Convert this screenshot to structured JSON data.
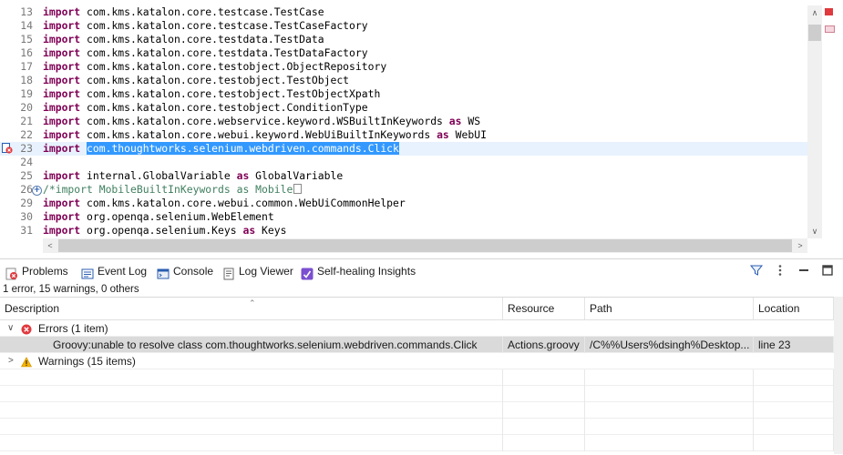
{
  "editor": {
    "lines": [
      {
        "num": "13",
        "kw": "import",
        "text": " com.kms.katalon.core.testcase.TestCase"
      },
      {
        "num": "14",
        "kw": "import",
        "text": " com.kms.katalon.core.testcase.TestCaseFactory"
      },
      {
        "num": "15",
        "kw": "import",
        "text": " com.kms.katalon.core.testdata.TestData"
      },
      {
        "num": "16",
        "kw": "import",
        "text": " com.kms.katalon.core.testdata.TestDataFactory"
      },
      {
        "num": "17",
        "kw": "import",
        "text": " com.kms.katalon.core.testobject.ObjectRepository"
      },
      {
        "num": "18",
        "kw": "import",
        "text": " com.kms.katalon.core.testobject.TestObject"
      },
      {
        "num": "19",
        "kw": "import",
        "text": " com.kms.katalon.core.testobject.TestObjectXpath"
      },
      {
        "num": "20",
        "kw": "import",
        "text": " com.kms.katalon.core.testobject.ConditionType"
      },
      {
        "num": "21",
        "kw": "import",
        "text": " com.kms.katalon.core.webservice.keyword.WSBuiltInKeywords ",
        "kw2": "as",
        "text2": " WS"
      },
      {
        "num": "22",
        "kw": "import",
        "text": " com.kms.katalon.core.webui.keyword.WebUiBuiltInKeywords ",
        "kw2": "as",
        "text2": " WebUI"
      },
      {
        "num": "23",
        "kw": "import",
        "text": " ",
        "selected": "com.thoughtworks.selenium.webdriven.commands.Click"
      },
      {
        "num": "24",
        "kw": "",
        "text": ""
      },
      {
        "num": "25",
        "kw": "import",
        "text": " internal.GlobalVariable ",
        "kw2": "as",
        "text2": " GlobalVariable"
      },
      {
        "num": "26",
        "comment": "/*import MobileBuiltInKeywords as Mobile"
      },
      {
        "num": "29",
        "kw": "import",
        "text": " com.kms.katalon.core.webui.common.WebUiCommonHelper"
      },
      {
        "num": "30",
        "kw": "import",
        "text": " org.openqa.selenium.WebElement"
      },
      {
        "num": "31",
        "kw": "import",
        "text": " org.openqa.selenium.Keys ",
        "kw2": "as",
        "text2": " Keys"
      }
    ]
  },
  "tabs": [
    {
      "label": "Problems",
      "icon": "problems-icon"
    },
    {
      "label": "Event Log",
      "icon": "event-log-icon"
    },
    {
      "label": "Console",
      "icon": "console-icon"
    },
    {
      "label": "Log Viewer",
      "icon": "log-viewer-icon"
    },
    {
      "label": "Self-healing Insights",
      "icon": "self-healing-icon"
    }
  ],
  "summary": "1 error, 15 warnings, 0 others",
  "table": {
    "columns": [
      "Description",
      "Resource",
      "Path",
      "Location"
    ],
    "errors_group": "Errors (1 item)",
    "error_row": {
      "description": "Groovy:unable to resolve class com.thoughtworks.selenium.webdriven.commands.Click",
      "resource": "Actions.groovy",
      "path": "/C%%Users%dsingh%Desktop...",
      "location": "line 23"
    },
    "warnings_group": "Warnings (15 items)"
  },
  "colors": {
    "keyword": "#7f0055",
    "selection": "#3399ff",
    "current_line": "#e8f2fe",
    "error": "#e0393e",
    "warning": "#f5b400"
  }
}
